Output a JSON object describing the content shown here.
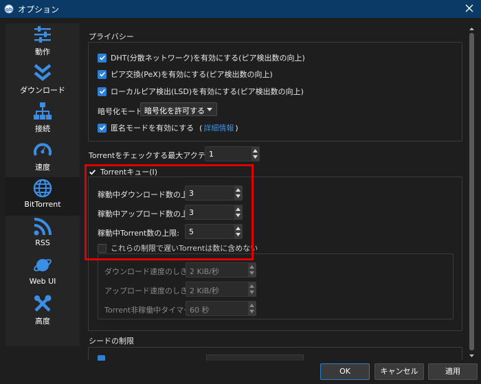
{
  "window": {
    "title": "オプション"
  },
  "sidebar": {
    "items": [
      {
        "label": "動作",
        "icon": "sliders-icon"
      },
      {
        "label": "ダウンロード",
        "icon": "double-chevron-down-icon"
      },
      {
        "label": "接続",
        "icon": "network-icon"
      },
      {
        "label": "速度",
        "icon": "speedometer-icon"
      },
      {
        "label": "BitTorrent",
        "icon": "globe-icon",
        "selected": true
      },
      {
        "label": "RSS",
        "icon": "rss-icon"
      },
      {
        "label": "Web UI",
        "icon": "planet-icon"
      },
      {
        "label": "高度",
        "icon": "tools-icon"
      }
    ]
  },
  "privacy": {
    "title": "プライバシー",
    "dht": "DHT(分散ネットワーク)を有効にする(ピア検出数の向上)",
    "pex": "ピア交換(PeX)を有効にする(ピア検出数の向上)",
    "lsd": "ローカルピア検出(LSD)を有効にする(ピア検出数の向上)",
    "encryption_label": "暗号化モード:",
    "encryption_value": "暗号化を許可する",
    "anonymous_label": "匿名モードを有効にする",
    "anonymous_paren_open": "(",
    "anonymous_link": "詳細情報",
    "anonymous_paren_close": ")"
  },
  "max_active_checking": {
    "label": "Torrentをチェックする最大アクティブ数",
    "value": "1"
  },
  "queue": {
    "title": "Torrentキュー(I)",
    "max_downloads_label": "稼動中ダウンロード数の上限:",
    "max_downloads_value": "3",
    "max_uploads_label": "稼動中アップロード数の上限:",
    "max_uploads_value": "3",
    "max_torrents_label": "稼動中Torrent数の上限:",
    "max_torrents_value": "5",
    "slow_torrents_label": "これらの制限で遅いTorrentは数に含めない",
    "dl_threshold_label": "ダウンロード速度のしきい値:",
    "dl_threshold_value": "2 KiB/秒",
    "ul_threshold_label": "アップロード速度のしきい値:",
    "ul_threshold_value": "2 KiB/秒",
    "inactive_timer_label": "Torrent非稼働中タイマー:",
    "inactive_timer_value": "60 秒"
  },
  "seeding": {
    "title": "シードの制限"
  },
  "buttons": {
    "ok": "OK",
    "cancel": "キャンセル",
    "apply": "適用"
  },
  "colors": {
    "titlebar": "#0b3a66",
    "accent": "#2e7fd6",
    "highlight_box": "#e00000",
    "icon_blue": "#3a8ee6"
  }
}
